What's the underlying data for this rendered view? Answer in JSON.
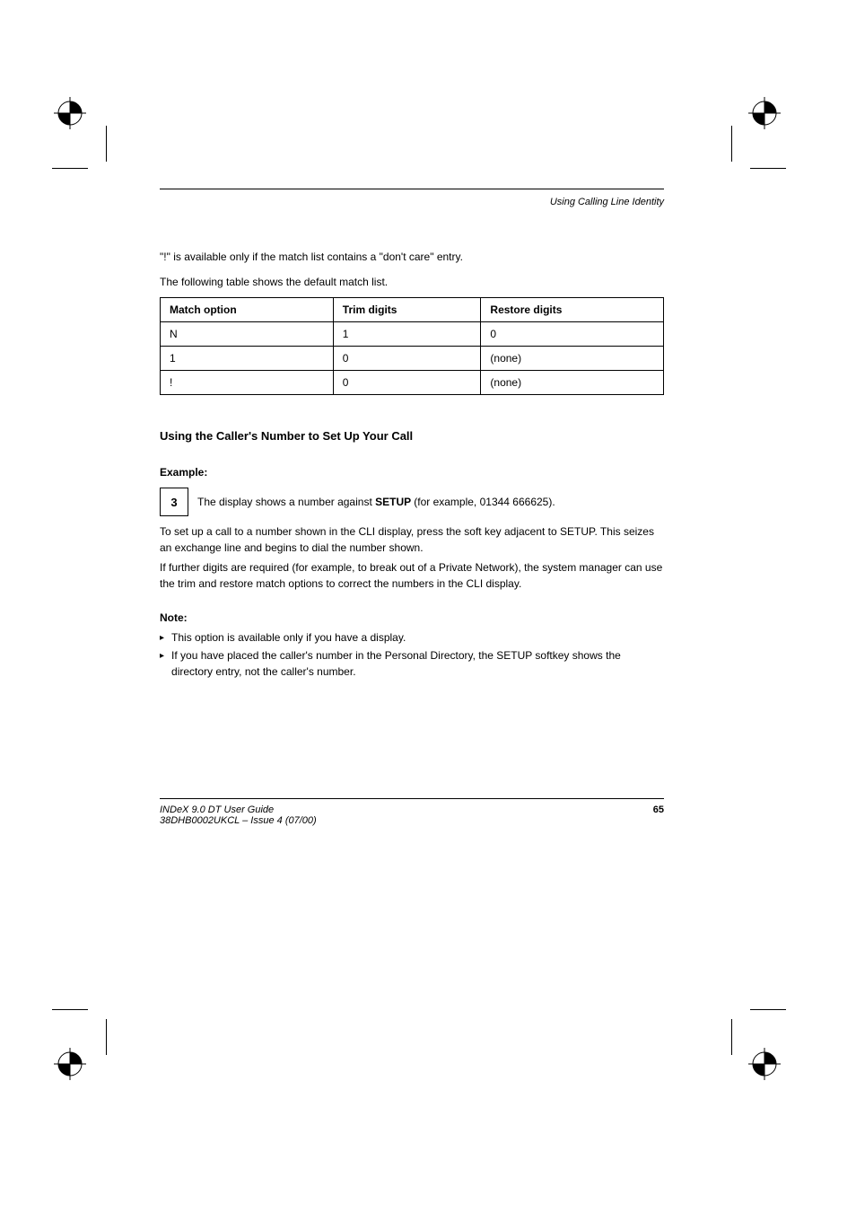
{
  "header": {
    "title": "Using Calling Line Identity"
  },
  "intro": "\"!\" is available only if the match list contains a \"don't care\" entry.",
  "table": {
    "caption": "The following table shows the default match list.",
    "headers": [
      "Match option",
      "Trim digits",
      "Restore digits"
    ],
    "rows": [
      [
        "N",
        "1",
        "0"
      ],
      [
        "1",
        "0",
        "(none)"
      ],
      [
        "!",
        "0",
        "(none)"
      ]
    ]
  },
  "section": {
    "heading": "Using the Caller's Number to Set Up Your Call",
    "example_label": "Example:",
    "key": "3",
    "example_text": "The display shows a number against ",
    "example_bold": "SETUP ",
    "example_after": "(for example, 01344 666625).",
    "paragraphs": [
      "To set up a call to a number shown in the CLI display, press the soft key adjacent to SETUP. This seizes an exchange line and begins to dial the number shown.",
      "If further digits are required (for example, to break out of a Private Network), the system manager can use the trim and restore match options to correct the numbers in the CLI display."
    ],
    "note_label": "Note:",
    "bullets": [
      "This option is available only if you have a display.",
      "If you have placed the caller's number in the Personal Directory, the SETUP softkey shows the directory entry, not the caller's number."
    ]
  },
  "footer": {
    "left": "INDeX 9.0 DT User Guide",
    "page": "65",
    "subtitle": "38DHB0002UKCL – Issue 4 (07/00)"
  }
}
